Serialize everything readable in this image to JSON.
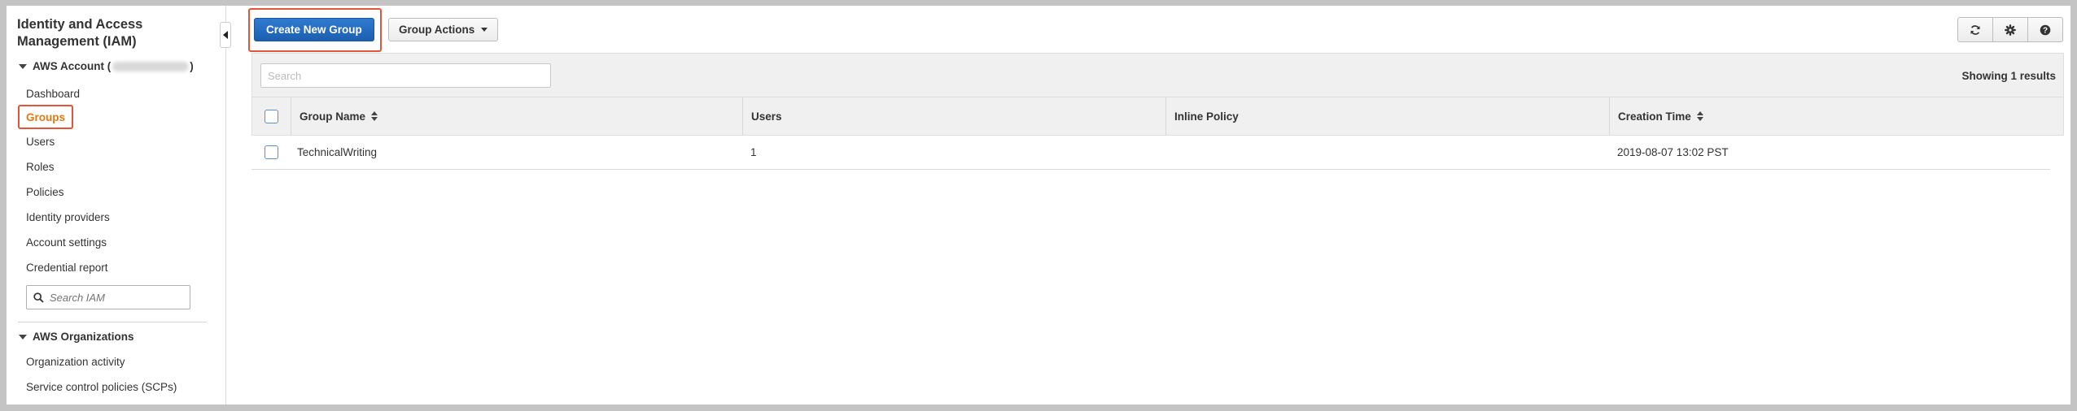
{
  "sidebar": {
    "title": "Identity and Access Management (IAM)",
    "account_label": "AWS Account (",
    "account_suffix": ")",
    "nav_items": [
      {
        "label": "Dashboard"
      },
      {
        "label": "Groups",
        "active": true
      },
      {
        "label": "Users"
      },
      {
        "label": "Roles"
      },
      {
        "label": "Policies"
      },
      {
        "label": "Identity providers"
      },
      {
        "label": "Account settings"
      },
      {
        "label": "Credential report"
      }
    ],
    "search_placeholder": "Search IAM",
    "org_section": "AWS Organizations",
    "org_items": [
      {
        "label": "Organization activity"
      },
      {
        "label": "Service control policies (SCPs)"
      }
    ]
  },
  "toolbar": {
    "create_label": "Create New Group",
    "actions_label": "Group Actions",
    "icons": [
      "refresh-icon",
      "gear-icon",
      "help-icon"
    ]
  },
  "filter": {
    "placeholder": "Search",
    "results_text": "Showing 1 results"
  },
  "table": {
    "columns": [
      "Group Name",
      "Users",
      "Inline Policy",
      "Creation Time"
    ],
    "rows": [
      {
        "group_name": "TechnicalWriting",
        "users": "1",
        "inline_policy": "",
        "creation_time": "2019-08-07 13:02 PST"
      }
    ]
  },
  "colors": {
    "primary_button": "#1c5fb0",
    "active_nav": "#e47911",
    "highlight_box": "#e2553b"
  }
}
